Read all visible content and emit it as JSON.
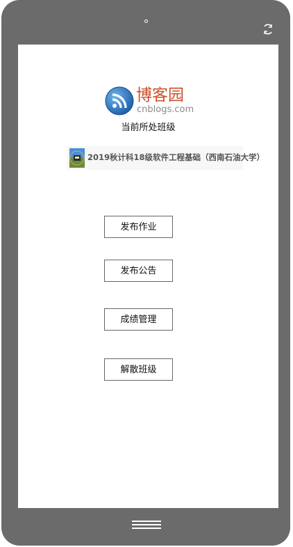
{
  "device": {
    "camera_icon": "camera-dot-icon",
    "rotate_icon": "rotate-icon",
    "home_icon": "home-bars-icon"
  },
  "logo": {
    "title": "博客园",
    "domain": "cnblogs.com",
    "icon": "rss-logo-icon",
    "colors": {
      "icon_blue": "#2b7fc4",
      "title": "#c9502b"
    }
  },
  "class_section": {
    "label": "当前所处班级",
    "class_name": "2019秋计科18级软件工程基础（西南石油大学）"
  },
  "actions": [
    {
      "label": "发布作业"
    },
    {
      "label": "发布公告"
    },
    {
      "label": "成绩管理"
    },
    {
      "label": "解散班级"
    }
  ]
}
